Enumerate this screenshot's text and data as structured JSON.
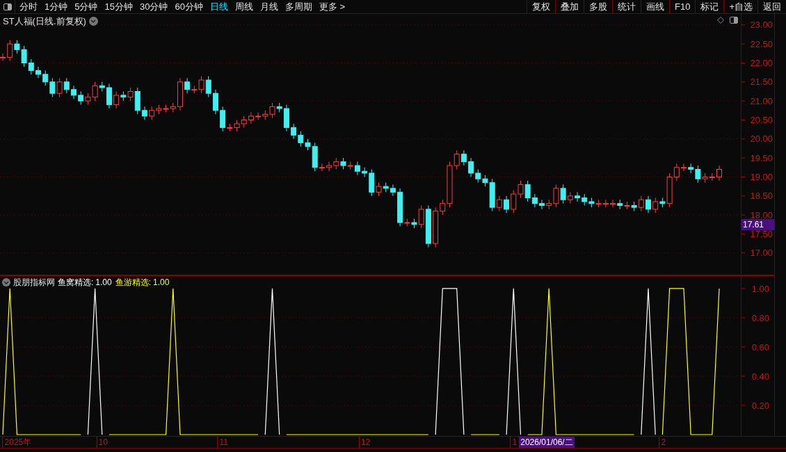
{
  "toolbar": {
    "tabs": [
      {
        "label": "分时",
        "selected": false
      },
      {
        "label": "1分钟",
        "selected": false
      },
      {
        "label": "5分钟",
        "selected": false
      },
      {
        "label": "15分钟",
        "selected": false
      },
      {
        "label": "30分钟",
        "selected": false
      },
      {
        "label": "60分钟",
        "selected": false
      },
      {
        "label": "日线",
        "selected": true
      },
      {
        "label": "周线",
        "selected": false
      },
      {
        "label": "月线",
        "selected": false
      },
      {
        "label": "多周期",
        "selected": false
      },
      {
        "label": "更多 >",
        "selected": false
      }
    ],
    "buttons": [
      "复权",
      "叠加",
      "多股",
      "统计",
      "画线",
      "F10",
      "标记",
      "+自选",
      "返回"
    ]
  },
  "price_panel": {
    "title": "ST人福(日线.前复权)",
    "price_cursor": "17.61",
    "chart_data": {
      "type": "candlestick",
      "ylim": [
        16.41,
        23.29
      ],
      "grid": true,
      "categories": [
        null,
        null,
        null,
        null,
        null,
        null,
        null,
        null,
        null,
        null,
        null,
        null,
        null,
        null,
        null,
        null,
        null,
        null,
        null,
        null,
        null,
        null,
        null,
        null,
        null,
        null,
        null,
        null,
        null,
        null,
        null,
        null,
        null,
        null,
        null,
        null,
        null,
        null,
        null,
        null,
        null,
        null,
        null,
        null,
        null,
        null,
        null,
        null,
        null,
        null,
        null,
        null,
        null,
        null,
        null,
        null,
        null,
        null,
        null,
        null,
        null,
        null,
        null,
        null,
        null,
        null,
        null,
        null,
        null,
        null,
        null,
        null,
        null,
        null,
        null,
        null,
        null,
        null,
        null,
        null,
        null,
        null,
        null,
        null,
        null,
        null,
        null,
        null,
        null,
        null,
        null,
        null,
        null,
        null,
        null,
        null,
        null,
        null,
        null,
        null,
        null,
        null
      ],
      "ohlc": [
        [
          22.15,
          22.25,
          22.05,
          22.15
        ],
        [
          22.15,
          22.6,
          22.05,
          22.5
        ],
        [
          22.5,
          22.6,
          22.25,
          22.35
        ],
        [
          22.35,
          22.45,
          21.9,
          22.0
        ],
        [
          22.0,
          22.1,
          21.7,
          21.8
        ],
        [
          21.8,
          21.9,
          21.6,
          21.7
        ],
        [
          21.7,
          21.8,
          21.4,
          21.5
        ],
        [
          21.5,
          21.6,
          21.1,
          21.2
        ],
        [
          21.2,
          21.6,
          21.1,
          21.5
        ],
        [
          21.5,
          21.6,
          21.2,
          21.3
        ],
        [
          21.3,
          21.4,
          21.05,
          21.15
        ],
        [
          21.15,
          21.25,
          20.9,
          21.0
        ],
        [
          21.0,
          21.2,
          20.9,
          21.1
        ],
        [
          21.1,
          21.5,
          21.0,
          21.4
        ],
        [
          21.4,
          21.5,
          21.25,
          21.35
        ],
        [
          21.35,
          21.45,
          20.8,
          20.9
        ],
        [
          20.9,
          21.25,
          20.8,
          21.15
        ],
        [
          21.15,
          21.25,
          21.0,
          21.1
        ],
        [
          21.1,
          21.35,
          21.0,
          21.25
        ],
        [
          21.25,
          21.35,
          20.65,
          20.75
        ],
        [
          20.75,
          20.85,
          20.5,
          20.6
        ],
        [
          20.6,
          20.85,
          20.5,
          20.75
        ],
        [
          20.75,
          20.9,
          20.65,
          20.8
        ],
        [
          20.8,
          20.9,
          20.7,
          20.8
        ],
        [
          20.8,
          20.95,
          20.7,
          20.85
        ],
        [
          20.85,
          21.6,
          20.75,
          21.5
        ],
        [
          21.5,
          21.6,
          21.2,
          21.3
        ],
        [
          21.3,
          21.4,
          21.2,
          21.3
        ],
        [
          21.3,
          21.65,
          21.2,
          21.55
        ],
        [
          21.55,
          21.65,
          21.1,
          21.2
        ],
        [
          21.2,
          21.3,
          20.65,
          20.75
        ],
        [
          20.75,
          20.85,
          20.2,
          20.3
        ],
        [
          20.3,
          20.4,
          20.2,
          20.3
        ],
        [
          20.3,
          20.5,
          20.2,
          20.4
        ],
        [
          20.4,
          20.6,
          20.3,
          20.5
        ],
        [
          20.5,
          20.7,
          20.4,
          20.6
        ],
        [
          20.6,
          20.7,
          20.5,
          20.6
        ],
        [
          20.6,
          20.75,
          20.5,
          20.65
        ],
        [
          20.65,
          20.95,
          20.55,
          20.85
        ],
        [
          20.85,
          20.95,
          20.7,
          20.8
        ],
        [
          20.8,
          20.9,
          20.2,
          20.3
        ],
        [
          20.3,
          20.4,
          20.0,
          20.1
        ],
        [
          20.1,
          20.2,
          19.8,
          19.9
        ],
        [
          19.9,
          20.0,
          19.7,
          19.8
        ],
        [
          19.8,
          19.9,
          19.15,
          19.25
        ],
        [
          19.25,
          19.35,
          19.15,
          19.25
        ],
        [
          19.25,
          19.4,
          19.15,
          19.3
        ],
        [
          19.3,
          19.5,
          19.2,
          19.4
        ],
        [
          19.4,
          19.5,
          19.2,
          19.3
        ],
        [
          19.3,
          19.4,
          19.2,
          19.3
        ],
        [
          19.3,
          19.4,
          19.05,
          19.15
        ],
        [
          19.15,
          19.25,
          19.0,
          19.1
        ],
        [
          19.1,
          19.2,
          18.5,
          18.6
        ],
        [
          18.6,
          18.85,
          18.5,
          18.75
        ],
        [
          18.75,
          18.85,
          18.6,
          18.7
        ],
        [
          18.7,
          18.8,
          18.5,
          18.6
        ],
        [
          18.6,
          18.7,
          17.7,
          17.8
        ],
        [
          17.8,
          17.9,
          17.7,
          17.8
        ],
        [
          17.8,
          17.9,
          17.65,
          17.75
        ],
        [
          17.75,
          18.25,
          17.65,
          18.15
        ],
        [
          18.15,
          18.25,
          17.15,
          17.25
        ],
        [
          17.25,
          18.2,
          17.15,
          18.1
        ],
        [
          18.1,
          18.4,
          18.0,
          18.3
        ],
        [
          18.3,
          19.4,
          18.2,
          19.3
        ],
        [
          19.3,
          19.7,
          19.2,
          19.6
        ],
        [
          19.6,
          19.7,
          19.3,
          19.4
        ],
        [
          19.4,
          19.5,
          19.0,
          19.1
        ],
        [
          19.1,
          19.2,
          18.85,
          18.95
        ],
        [
          18.95,
          19.05,
          18.75,
          18.85
        ],
        [
          18.85,
          18.95,
          18.1,
          18.2
        ],
        [
          18.2,
          18.5,
          18.1,
          18.4
        ],
        [
          18.4,
          18.5,
          18.05,
          18.15
        ],
        [
          18.15,
          18.65,
          18.05,
          18.55
        ],
        [
          18.55,
          18.9,
          18.45,
          18.8
        ],
        [
          18.8,
          18.9,
          18.35,
          18.45
        ],
        [
          18.45,
          18.55,
          18.2,
          18.3
        ],
        [
          18.3,
          18.4,
          18.15,
          18.25
        ],
        [
          18.25,
          18.4,
          18.15,
          18.3
        ],
        [
          18.3,
          18.8,
          18.2,
          18.7
        ],
        [
          18.7,
          18.8,
          18.3,
          18.4
        ],
        [
          18.4,
          18.6,
          18.3,
          18.5
        ],
        [
          18.5,
          18.6,
          18.35,
          18.45
        ],
        [
          18.45,
          18.55,
          18.25,
          18.35
        ],
        [
          18.35,
          18.45,
          18.2,
          18.3
        ],
        [
          18.3,
          18.4,
          18.2,
          18.3
        ],
        [
          18.3,
          18.4,
          18.2,
          18.3
        ],
        [
          18.3,
          18.4,
          18.2,
          18.3
        ],
        [
          18.3,
          18.4,
          18.15,
          18.25
        ],
        [
          18.25,
          18.35,
          18.15,
          18.25
        ],
        [
          18.25,
          18.35,
          18.1,
          18.2
        ],
        [
          18.2,
          18.5,
          18.1,
          18.4
        ],
        [
          18.4,
          18.5,
          18.05,
          18.15
        ],
        [
          18.15,
          18.45,
          18.05,
          18.35
        ],
        [
          18.35,
          18.45,
          18.2,
          18.3
        ],
        [
          18.3,
          19.1,
          18.2,
          19.0
        ],
        [
          19.0,
          19.35,
          18.9,
          19.25
        ],
        [
          19.25,
          19.35,
          19.15,
          19.25
        ],
        [
          19.25,
          19.35,
          19.1,
          19.2
        ],
        [
          19.2,
          19.3,
          18.85,
          18.95
        ],
        [
          18.95,
          19.1,
          18.85,
          19.0
        ],
        [
          19.0,
          19.1,
          18.9,
          19.0
        ],
        [
          19.0,
          19.3,
          18.9,
          19.2
        ]
      ],
      "yticks": [
        {
          "value": 23,
          "label": "23.00"
        },
        {
          "value": 22.5,
          "label": "22.50"
        },
        {
          "value": 22,
          "label": "22.00"
        },
        {
          "value": 21.5,
          "label": "21.50"
        },
        {
          "value": 21,
          "label": "21.00"
        },
        {
          "value": 20.5,
          "label": "20.50"
        },
        {
          "value": 20,
          "label": "20.00"
        },
        {
          "value": 19.5,
          "label": "19.50"
        },
        {
          "value": 19,
          "label": "19.00"
        },
        {
          "value": 18.5,
          "label": "18.50"
        },
        {
          "value": 18,
          "label": "18.00"
        },
        {
          "value": 17.5,
          "label": "17.50"
        },
        {
          "value": 17,
          "label": "17.00"
        }
      ]
    }
  },
  "indicator_panel": {
    "title": "股朋指标网",
    "legend_values": [
      "1.00",
      "1.00"
    ],
    "cursor_date": "2026/01/06/二",
    "chart_data": {
      "type": "line",
      "ylim": [
        0,
        1.09
      ],
      "grid": true,
      "categories": [
        null,
        null,
        "2025年",
        null,
        null,
        null,
        null,
        null,
        null,
        null,
        null,
        null,
        null,
        null,
        "10",
        null,
        null,
        null,
        null,
        null,
        null,
        null,
        null,
        null,
        null,
        null,
        null,
        null,
        null,
        null,
        null,
        "11",
        null,
        null,
        null,
        null,
        null,
        null,
        null,
        null,
        null,
        null,
        null,
        null,
        null,
        null,
        null,
        null,
        null,
        null,
        null,
        "12",
        null,
        null,
        null,
        null,
        null,
        null,
        null,
        null,
        null,
        null,
        null,
        null,
        null,
        null,
        null,
        null,
        null,
        null,
        null,
        null,
        "1",
        null,
        null,
        null,
        null,
        null,
        null,
        null,
        null,
        null,
        null,
        null,
        null,
        null,
        null,
        null,
        null,
        null,
        null,
        null,
        null,
        "2",
        null,
        null,
        null,
        null,
        null,
        null,
        null,
        null
      ],
      "series": [
        {
          "name": "鱼窝精选:",
          "color": "#ffffff",
          "values": [
            null,
            null,
            null,
            null,
            null,
            null,
            null,
            null,
            null,
            null,
            null,
            null,
            0,
            1,
            0,
            null,
            null,
            null,
            null,
            null,
            null,
            null,
            null,
            null,
            null,
            null,
            null,
            null,
            null,
            null,
            null,
            null,
            null,
            null,
            null,
            null,
            null,
            0,
            1,
            0,
            null,
            null,
            null,
            null,
            null,
            null,
            null,
            null,
            null,
            null,
            null,
            null,
            null,
            null,
            null,
            null,
            null,
            null,
            null,
            null,
            null,
            0,
            1,
            1,
            1,
            0,
            null,
            null,
            null,
            null,
            null,
            0,
            1,
            0,
            null,
            null,
            null,
            null,
            null,
            null,
            null,
            null,
            null,
            null,
            null,
            null,
            null,
            null,
            null,
            null,
            0,
            1,
            0,
            null,
            null,
            null,
            null,
            null,
            null,
            null,
            null,
            null
          ]
        },
        {
          "name": "鱼游精选:",
          "color": "#ffff00",
          "values": [
            0,
            1,
            0,
            0,
            0,
            0,
            0,
            0,
            0,
            0,
            0,
            0,
            null,
            null,
            null,
            0,
            0,
            0,
            0,
            0,
            0,
            0,
            0,
            0,
            1,
            0,
            0,
            0,
            0,
            0,
            0,
            0,
            0,
            0,
            0,
            0,
            0,
            null,
            null,
            null,
            0,
            0,
            0,
            0,
            0,
            0,
            0,
            0,
            0,
            0,
            0,
            0,
            0,
            0,
            0,
            0,
            0,
            0,
            0,
            0,
            0,
            null,
            null,
            null,
            null,
            null,
            0,
            0,
            0,
            0,
            0,
            null,
            null,
            null,
            0,
            0,
            0,
            1,
            0,
            0,
            0,
            0,
            0,
            0,
            0,
            0,
            0,
            0,
            0,
            0,
            null,
            null,
            null,
            0,
            1,
            1,
            1,
            0,
            0,
            0,
            0,
            1
          ]
        }
      ],
      "yticks": [
        {
          "value": 1,
          "label": "1.00"
        },
        {
          "value": 0.8,
          "label": "0.80"
        },
        {
          "value": 0.6,
          "label": "0.60"
        },
        {
          "value": 0.4,
          "label": "0.40"
        },
        {
          "value": 0.2,
          "label": "0.20"
        }
      ]
    }
  }
}
